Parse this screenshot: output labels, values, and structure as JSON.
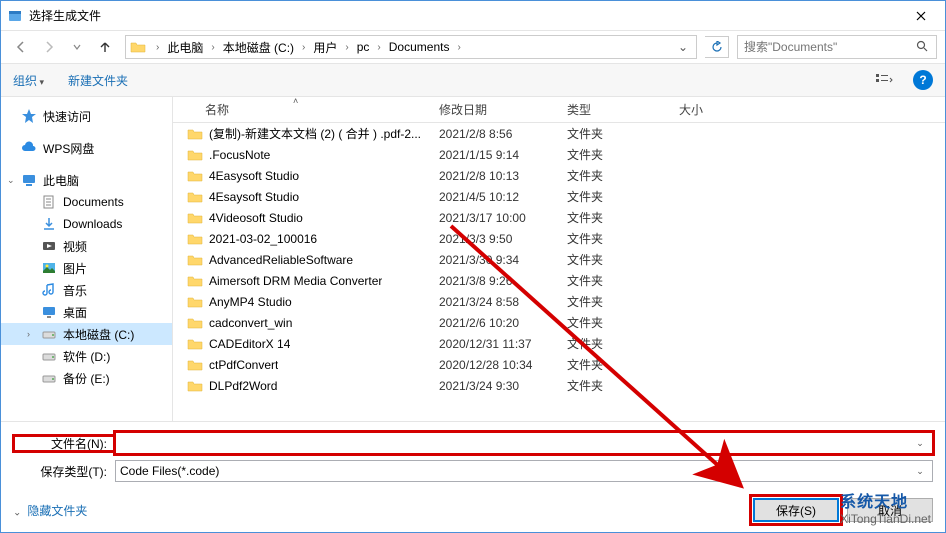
{
  "window": {
    "title": "选择生成文件"
  },
  "nav": {
    "breadcrumb": [
      "此电脑",
      "本地磁盘 (C:)",
      "用户",
      "pc",
      "Documents"
    ],
    "search_placeholder": "搜索\"Documents\""
  },
  "toolbar": {
    "organize": "组织",
    "new_folder": "新建文件夹"
  },
  "sidebar": {
    "quick_access": "快速访问",
    "wps": "WPS网盘",
    "this_pc": "此电脑",
    "documents": "Documents",
    "downloads": "Downloads",
    "videos": "视频",
    "pictures": "图片",
    "music": "音乐",
    "desktop": "桌面",
    "drive_c": "本地磁盘 (C:)",
    "drive_d": "软件 (D:)",
    "drive_e": "备份 (E:)"
  },
  "columns": {
    "name": "名称",
    "date": "修改日期",
    "type": "类型",
    "size": "大小"
  },
  "type_folder": "文件夹",
  "files": [
    {
      "name": "(复制)-新建文本文档 (2) ( 合并 ) .pdf-2...",
      "date": "2021/2/8 8:56"
    },
    {
      "name": ".FocusNote",
      "date": "2021/1/15 9:14"
    },
    {
      "name": "4Easysoft Studio",
      "date": "2021/2/8 10:13"
    },
    {
      "name": "4Esaysoft Studio",
      "date": "2021/4/5 10:12"
    },
    {
      "name": "4Videosoft Studio",
      "date": "2021/3/17 10:00"
    },
    {
      "name": "2021-03-02_100016",
      "date": "2021/3/3 9:50"
    },
    {
      "name": "AdvancedReliableSoftware",
      "date": "2021/3/30 9:34"
    },
    {
      "name": "Aimersoft DRM Media Converter",
      "date": "2021/3/8 9:26"
    },
    {
      "name": "AnyMP4 Studio",
      "date": "2021/3/24 8:58"
    },
    {
      "name": "cadconvert_win",
      "date": "2021/2/6 10:20"
    },
    {
      "name": "CADEditorX 14",
      "date": "2020/12/31 11:37"
    },
    {
      "name": "ctPdfConvert",
      "date": "2020/12/28 10:34"
    },
    {
      "name": "DLPdf2Word",
      "date": "2021/3/24 9:30"
    }
  ],
  "form": {
    "filename_label": "文件名(N):",
    "filename_value": "",
    "filetype_label": "保存类型(T):",
    "filetype_value": "Code Files(*.code)"
  },
  "actions": {
    "hide_folders": "隐藏文件夹",
    "save": "保存(S)",
    "cancel": "取消"
  },
  "watermark": {
    "brand": "系统天地",
    "url": "XiTongTianDi.net"
  }
}
